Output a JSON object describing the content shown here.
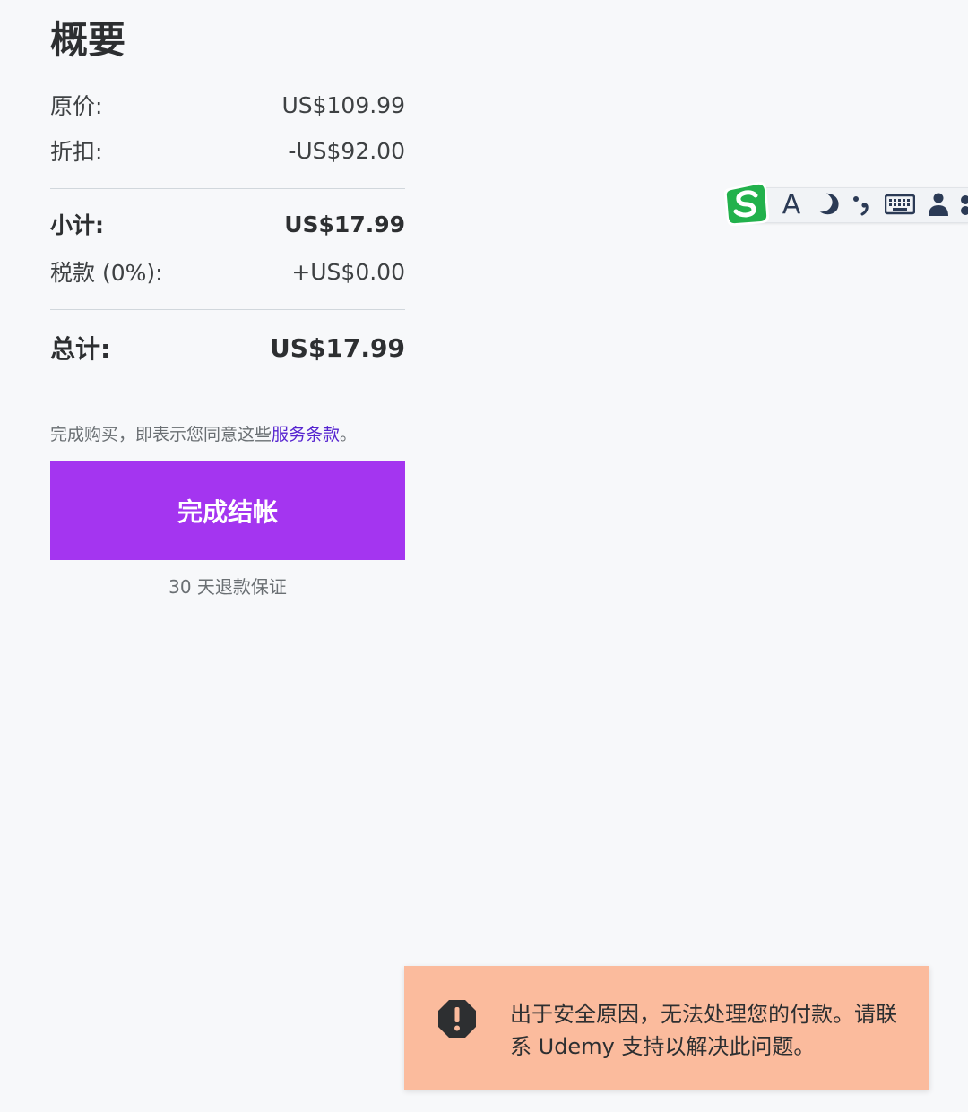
{
  "summary": {
    "title": "概要",
    "original_label": "原价:",
    "original_value": "US$109.99",
    "discount_label": "折扣:",
    "discount_value": "-US$92.00",
    "subtotal_label": "小计:",
    "subtotal_value": "US$17.99",
    "tax_label": "税款 (0%):",
    "tax_value": "+US$0.00",
    "total_label": "总计:",
    "total_value": "US$17.99",
    "terms_prefix": "完成购买，即表示您同意这些",
    "terms_link": "服务条款",
    "terms_suffix": "。",
    "checkout_label": "完成结帐",
    "guarantee": "30 天退款保证"
  },
  "ime_toolbar": {
    "logo_letter": "S",
    "icons": [
      "sogou-logo-icon",
      "text-mode-icon",
      "moon-icon",
      "punctuation-icon",
      "keyboard-icon",
      "user-icon"
    ],
    "letter_a": "A",
    "accent_color": "#22b14c"
  },
  "toast": {
    "message": "出于安全原因，无法处理您的付款。请联系 Udemy 支持以解决此问题。",
    "icon": "alert-octagon-icon",
    "background": "#fbbb9d"
  },
  "colors": {
    "brand_purple": "#a435f0",
    "link_purple": "#5624d0",
    "text": "#2d2f31",
    "page_bg": "#f7f8fa"
  }
}
